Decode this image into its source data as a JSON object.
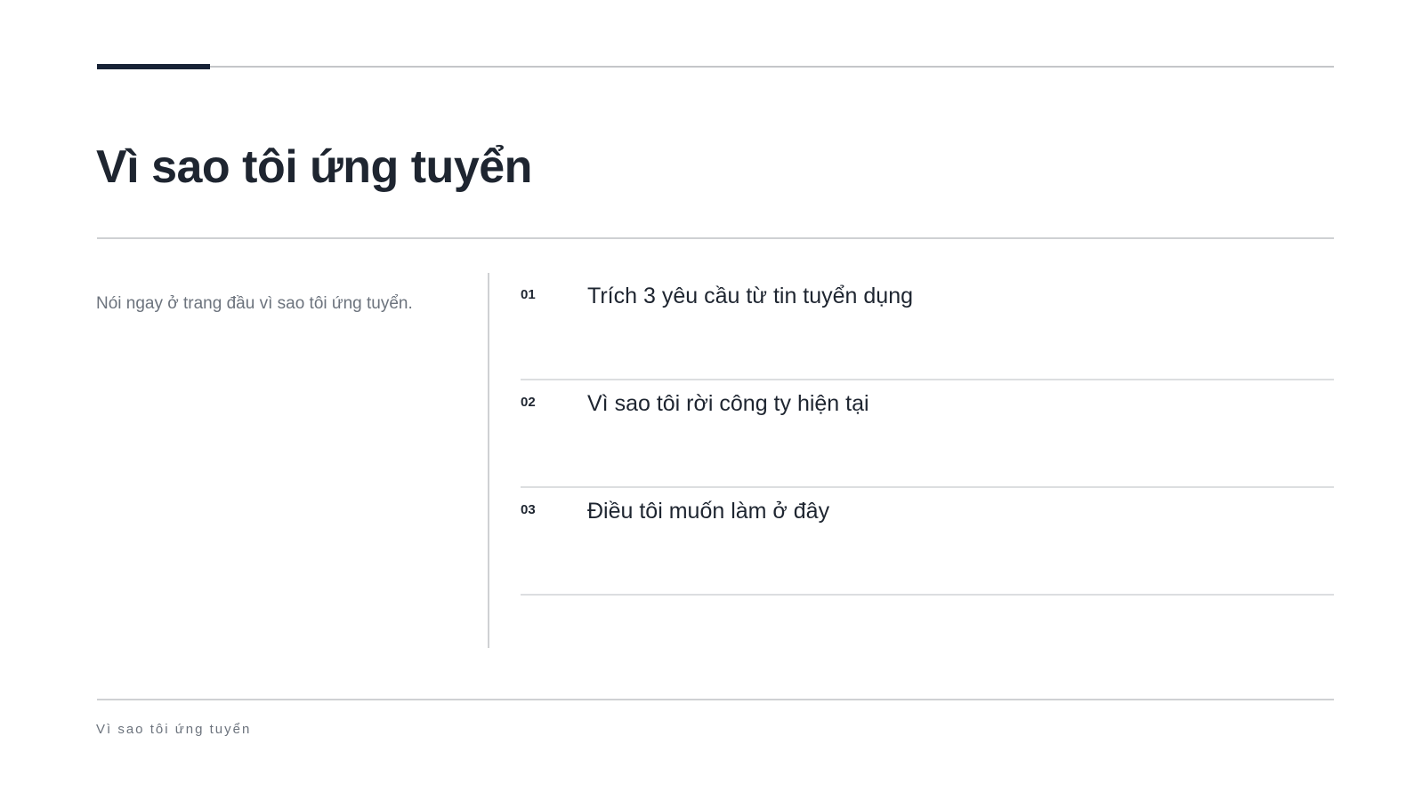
{
  "slide": {
    "title": "Vì sao tôi ứng tuyển",
    "intro": "Nói ngay ở trang đầu vì sao tôi ứng tuyển.",
    "reasons": [
      {
        "number": "01",
        "text": "Trích 3 yêu cầu từ tin tuyển dụng"
      },
      {
        "number": "02",
        "text": "Vì sao tôi rời công ty hiện tại"
      },
      {
        "number": "03",
        "text": "Điều tôi muốn làm ở đây"
      }
    ],
    "footer": "Vì sao tôi ứng tuyển"
  },
  "colors": {
    "accent": "#172236",
    "text_primary": "#1e2530",
    "text_muted": "#6c737d",
    "rule": "#cfd1d3"
  }
}
